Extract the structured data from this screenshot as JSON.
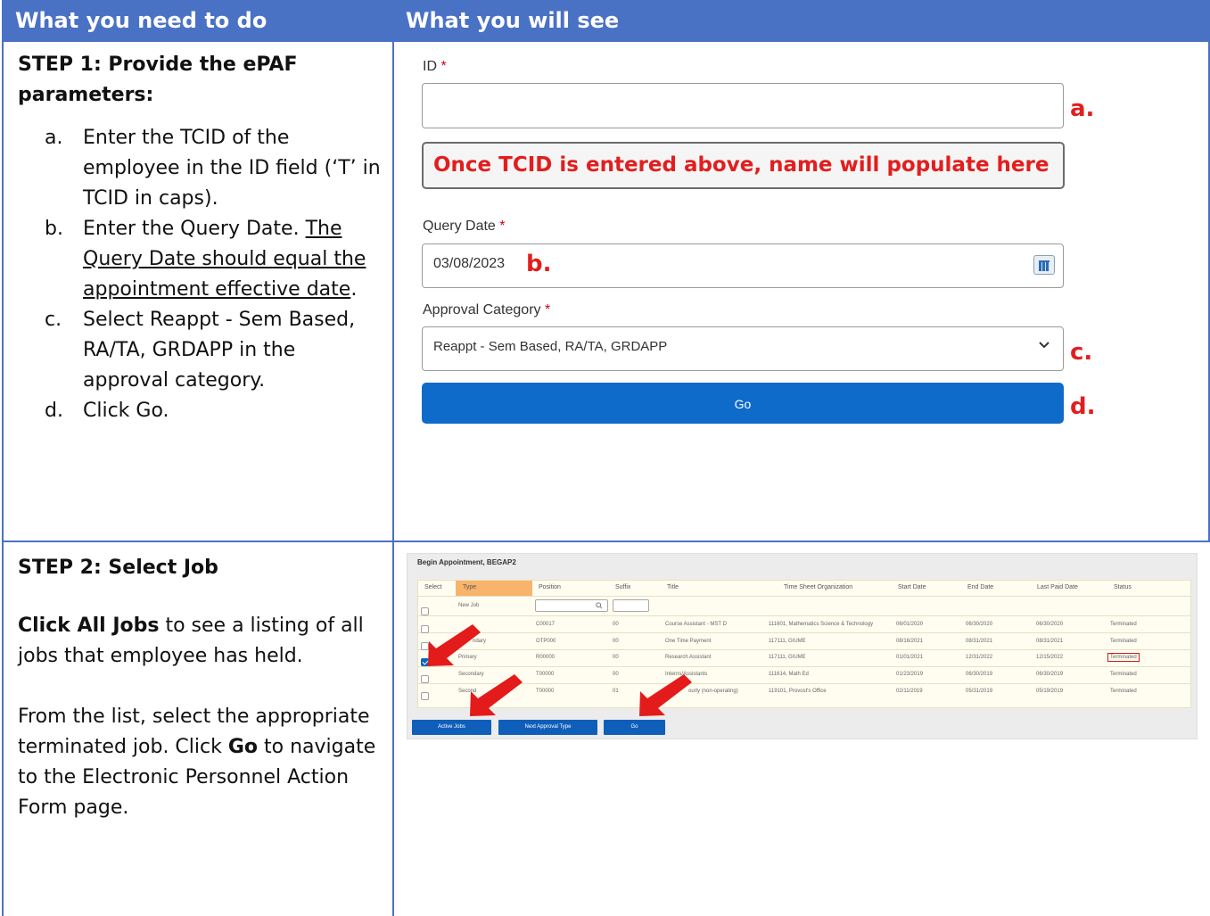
{
  "header": {
    "left": "What you need to do",
    "right": "What you will see"
  },
  "step1": {
    "title": "STEP 1: Provide the ePAF parameters:",
    "items": [
      {
        "marker": "a.",
        "text": "Enter the TCID of the employee in the ID field (‘T’ in TCID in caps)."
      },
      {
        "marker": "b.",
        "text_before": "Enter the Query Date. ",
        "text_underlined": "The Query Date should equal the appointment effective date",
        "text_after": "."
      },
      {
        "marker": "c.",
        "text": "Select Reappt - Sem Based, RA/TA, GRDAPP in the approval category."
      },
      {
        "marker": "d.",
        "text": "Click Go."
      }
    ]
  },
  "form": {
    "id_label": "ID",
    "required_mark": "*",
    "id_value": "",
    "name_placeholder": "Once TCID is entered above, name will populate here",
    "query_date_label": "Query Date",
    "query_date_value": "03/08/2023",
    "approval_category_label": "Approval Category",
    "approval_category_value": "Reappt - Sem Based, RA/TA, GRDAPP",
    "go_label": "Go",
    "annotations": {
      "a": "a.",
      "b": "b.",
      "c": "c.",
      "d": "d."
    },
    "icons": {
      "calendar": "calendar-icon",
      "dropdown": "chevron-down-icon"
    }
  },
  "step2": {
    "title": "STEP 2: Select Job",
    "para1_bold": "Click All Jobs",
    "para1_rest": " to see a listing of all jobs that employee has held.",
    "para2_before": "From the list, select the appropriate terminated job. Click ",
    "para2_bold": "Go",
    "para2_after": " to navigate to the Electronic Personnel Action Form page."
  },
  "job_screen": {
    "title": "Begin Appointment, BEGAP2",
    "columns": [
      "Select",
      "Type",
      "Position",
      "Suffix",
      "Title",
      "Time Sheet Organization",
      "Start Date",
      "End Date",
      "Last Paid Date",
      "Status"
    ],
    "new_job_label": "New Job",
    "rows": [
      {
        "type": "",
        "position": "C00017",
        "suffix": "00",
        "title": "Course Assistant - MST D",
        "org": "111601, Mathematics Science & Technology",
        "start": "06/01/2020",
        "end": "06/30/2020",
        "last_paid": "06/30/2020",
        "status": "Terminated",
        "checked": false
      },
      {
        "type": "ndary",
        "position": "OTP000",
        "suffix": "00",
        "title": "One Time Payment",
        "org": "117111, GIUME",
        "start": "08/16/2021",
        "end": "08/31/2021",
        "last_paid": "08/31/2021",
        "status": "Terminated",
        "checked": false
      },
      {
        "type": "Primary",
        "position": "R00000",
        "suffix": "00",
        "title": "Research Assistant",
        "org": "117111, GIUME",
        "start": "01/01/2021",
        "end": "12/31/2022",
        "last_paid": "12/15/2022",
        "status": "Terminated",
        "checked": true
      },
      {
        "type": "Secondary",
        "position": "T00000",
        "suffix": "00",
        "title": "Interns/Assistants",
        "org": "111614, Math Ed",
        "start": "01/23/2019",
        "end": "06/30/2019",
        "last_paid": "06/30/2019",
        "status": "Terminated",
        "checked": false
      },
      {
        "type": "Second",
        "position": "T00000",
        "suffix": "01",
        "title": "ourly (non-operating)",
        "org": "119101, Provost's Office",
        "start": "02/11/2019",
        "end": "05/31/2019",
        "last_paid": "05/19/2019",
        "status": "Terminated",
        "checked": false
      }
    ],
    "buttons": {
      "active_jobs": "Active Jobs",
      "next_approval_type": "Next Approval Type",
      "go": "Go"
    },
    "colors": {
      "accent": "#0f5fba",
      "type_highlight": "#f8b46a",
      "arrow": "#e31b1b"
    }
  }
}
